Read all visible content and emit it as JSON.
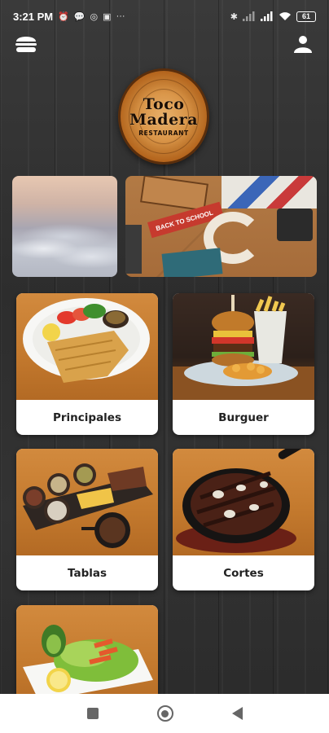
{
  "status_bar": {
    "time": "3:21 PM",
    "left_icons": [
      "alarm-icon",
      "chat-icon",
      "instagram-icon",
      "gallery-icon"
    ],
    "overflow": "···",
    "right_icons": [
      "bluetooth-icon",
      "signal-icon",
      "signal-icon",
      "wifi-icon"
    ],
    "battery": "61"
  },
  "app_bar": {
    "menu_icon": "burger-icon",
    "profile_icon": "user-icon"
  },
  "logo": {
    "line1": "Toco",
    "line2": "Madera",
    "line3": "RESTAURANT"
  },
  "banners": [
    {
      "name": "clouds-banner"
    },
    {
      "name": "back-to-school-banner",
      "text": "BACK TO SCHOOL"
    }
  ],
  "categories": [
    {
      "label": "Principales"
    },
    {
      "label": "Burguer"
    },
    {
      "label": "Tablas"
    },
    {
      "label": "Cortes"
    },
    {
      "label": ""
    }
  ],
  "colors": {
    "card_bg": "#ffffff",
    "label_text": "#222222",
    "wood_bg": "#c47a2e",
    "nav_icons": "#666666"
  }
}
